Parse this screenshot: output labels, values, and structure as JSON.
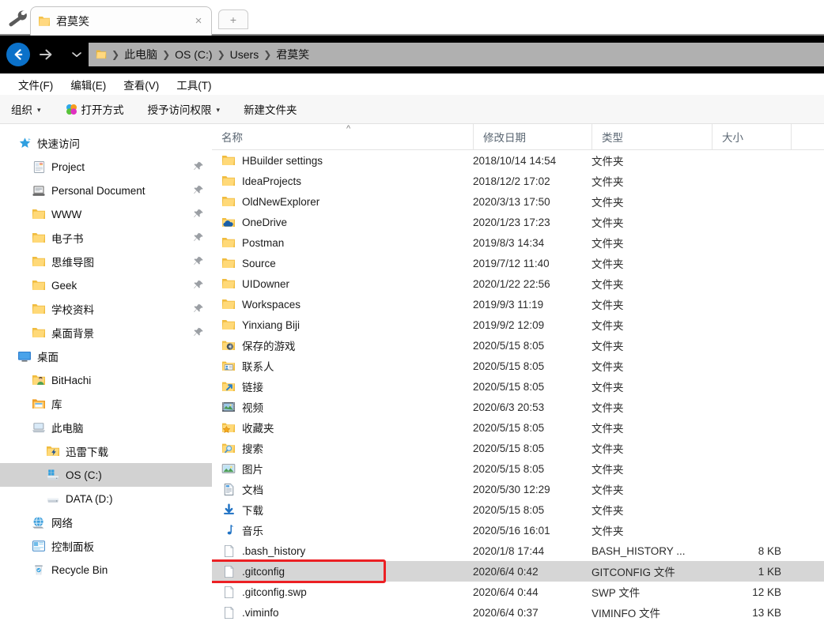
{
  "window": {
    "tab": {
      "title": "君莫笑",
      "icon": "folder-icon",
      "close_label": "×"
    },
    "new_tab_label": "+",
    "tools_icon": "wrench-icon"
  },
  "navigation": {
    "back_icon": "back-arrow-icon",
    "forward_icon": "forward-arrow-icon",
    "history_icon": "chevron-down-icon",
    "address_icon": "folder-icon",
    "breadcrumbs": [
      "此电脑",
      "OS (C:)",
      "Users",
      "君莫笑"
    ],
    "separator": "❯"
  },
  "menubar": {
    "items": [
      "文件(F)",
      "编辑(E)",
      "查看(V)",
      "工具(T)"
    ]
  },
  "commandbar": {
    "items": [
      {
        "label": "组织",
        "icon": null,
        "caret": "▾"
      },
      {
        "label": "打开方式",
        "icon": "open-with-icon",
        "caret": null
      },
      {
        "label": "授予访问权限",
        "icon": null,
        "caret": "▾"
      },
      {
        "label": "新建文件夹",
        "icon": null,
        "caret": null
      }
    ]
  },
  "sidebar": {
    "items": [
      {
        "label": "快速访问",
        "icon": "star-icon",
        "level": 0,
        "pinned": false,
        "selected": false
      },
      {
        "label": "Project",
        "icon": "project-icon",
        "level": 1,
        "pinned": true,
        "selected": false
      },
      {
        "label": "Personal Document",
        "icon": "document-icon",
        "level": 1,
        "pinned": true,
        "selected": false
      },
      {
        "label": "WWW",
        "icon": "folder-icon",
        "level": 1,
        "pinned": true,
        "selected": false
      },
      {
        "label": "电子书",
        "icon": "folder-icon",
        "level": 1,
        "pinned": true,
        "selected": false
      },
      {
        "label": "思维导图",
        "icon": "folder-icon",
        "level": 1,
        "pinned": true,
        "selected": false
      },
      {
        "label": "Geek",
        "icon": "folder-icon",
        "level": 1,
        "pinned": true,
        "selected": false
      },
      {
        "label": "学校资料",
        "icon": "folder-icon",
        "level": 1,
        "pinned": true,
        "selected": false
      },
      {
        "label": "桌面背景",
        "icon": "folder-icon",
        "level": 1,
        "pinned": true,
        "selected": false
      },
      {
        "label": "桌面",
        "icon": "desktop-icon",
        "level": 0,
        "pinned": false,
        "selected": false
      },
      {
        "label": "BitHachi",
        "icon": "user-folder-icon",
        "level": 1,
        "pinned": false,
        "selected": false
      },
      {
        "label": "库",
        "icon": "library-icon",
        "level": 1,
        "pinned": false,
        "selected": false
      },
      {
        "label": "此电脑",
        "icon": "computer-icon",
        "level": 1,
        "pinned": false,
        "selected": false
      },
      {
        "label": "迅雷下载",
        "icon": "thunder-folder-icon",
        "level": 2,
        "pinned": false,
        "selected": false
      },
      {
        "label": "OS (C:)",
        "icon": "windows-drive-icon",
        "level": 2,
        "pinned": false,
        "selected": true
      },
      {
        "label": "DATA (D:)",
        "icon": "drive-icon",
        "level": 2,
        "pinned": false,
        "selected": false
      },
      {
        "label": "网络",
        "icon": "network-icon",
        "level": 1,
        "pinned": false,
        "selected": false
      },
      {
        "label": "控制面板",
        "icon": "control-panel-icon",
        "level": 1,
        "pinned": false,
        "selected": false
      },
      {
        "label": "Recycle Bin",
        "icon": "recycle-bin-icon",
        "level": 1,
        "pinned": false,
        "selected": false
      }
    ]
  },
  "filelist": {
    "columns": [
      "名称",
      "修改日期",
      "类型",
      "大小"
    ],
    "sort_column": "名称",
    "sort_indicator": "^",
    "rows": [
      {
        "name": "HBuilder settings",
        "date": "2018/10/14 14:54",
        "type": "文件夹",
        "size": "",
        "icon": "folder-icon",
        "selected": false
      },
      {
        "name": "IdeaProjects",
        "date": "2018/12/2 17:02",
        "type": "文件夹",
        "size": "",
        "icon": "folder-icon",
        "selected": false
      },
      {
        "name": "OldNewExplorer",
        "date": "2020/3/13 17:50",
        "type": "文件夹",
        "size": "",
        "icon": "folder-icon",
        "selected": false
      },
      {
        "name": "OneDrive",
        "date": "2020/1/23 17:23",
        "type": "文件夹",
        "size": "",
        "icon": "onedrive-icon",
        "selected": false
      },
      {
        "name": "Postman",
        "date": "2019/8/3 14:34",
        "type": "文件夹",
        "size": "",
        "icon": "folder-icon",
        "selected": false
      },
      {
        "name": "Source",
        "date": "2019/7/12 11:40",
        "type": "文件夹",
        "size": "",
        "icon": "folder-icon",
        "selected": false
      },
      {
        "name": "UIDowner",
        "date": "2020/1/22 22:56",
        "type": "文件夹",
        "size": "",
        "icon": "folder-icon",
        "selected": false
      },
      {
        "name": "Workspaces",
        "date": "2019/9/3 11:19",
        "type": "文件夹",
        "size": "",
        "icon": "folder-icon",
        "selected": false
      },
      {
        "name": "Yinxiang Biji",
        "date": "2019/9/2 12:09",
        "type": "文件夹",
        "size": "",
        "icon": "folder-icon",
        "selected": false
      },
      {
        "name": "保存的游戏",
        "date": "2020/5/15 8:05",
        "type": "文件夹",
        "size": "",
        "icon": "saved-games-icon",
        "selected": false
      },
      {
        "name": "联系人",
        "date": "2020/5/15 8:05",
        "type": "文件夹",
        "size": "",
        "icon": "contacts-icon",
        "selected": false
      },
      {
        "name": "链接",
        "date": "2020/5/15 8:05",
        "type": "文件夹",
        "size": "",
        "icon": "links-icon",
        "selected": false
      },
      {
        "name": "视频",
        "date": "2020/6/3 20:53",
        "type": "文件夹",
        "size": "",
        "icon": "videos-icon",
        "selected": false
      },
      {
        "name": "收藏夹",
        "date": "2020/5/15 8:05",
        "type": "文件夹",
        "size": "",
        "icon": "favorites-icon",
        "selected": false
      },
      {
        "name": "搜索",
        "date": "2020/5/15 8:05",
        "type": "文件夹",
        "size": "",
        "icon": "searches-icon",
        "selected": false
      },
      {
        "name": "图片",
        "date": "2020/5/15 8:05",
        "type": "文件夹",
        "size": "",
        "icon": "pictures-icon",
        "selected": false
      },
      {
        "name": "文档",
        "date": "2020/5/30 12:29",
        "type": "文件夹",
        "size": "",
        "icon": "documents-icon",
        "selected": false
      },
      {
        "name": "下载",
        "date": "2020/5/15 8:05",
        "type": "文件夹",
        "size": "",
        "icon": "downloads-icon",
        "selected": false
      },
      {
        "name": "音乐",
        "date": "2020/5/16 16:01",
        "type": "文件夹",
        "size": "",
        "icon": "music-icon",
        "selected": false
      },
      {
        "name": ".bash_history",
        "date": "2020/1/8 17:44",
        "type": "BASH_HISTORY ...",
        "size": "8 KB",
        "icon": "file-icon",
        "selected": false
      },
      {
        "name": ".gitconfig",
        "date": "2020/6/4 0:42",
        "type": "GITCONFIG 文件",
        "size": "1 KB",
        "icon": "file-icon",
        "selected": true
      },
      {
        "name": ".gitconfig.swp",
        "date": "2020/6/4 0:44",
        "type": "SWP 文件",
        "size": "12 KB",
        "icon": "file-icon",
        "selected": false
      },
      {
        "name": ".viminfo",
        "date": "2020/6/4 0:37",
        "type": "VIMINFO 文件",
        "size": "13 KB",
        "icon": "file-icon",
        "selected": false
      }
    ]
  },
  "annotation": {
    "color": "#ec2024",
    "target_row": ".gitconfig"
  },
  "colors": {
    "accent_blue": "#0b71c9",
    "navbar_black": "#000000",
    "address_gray": "#b0b0b0",
    "selection_gray": "#d6d6d6",
    "sidebar_selection": "#d2d2d2",
    "annotation_red": "#ec2024",
    "folder_yellow": "#ffd264"
  }
}
